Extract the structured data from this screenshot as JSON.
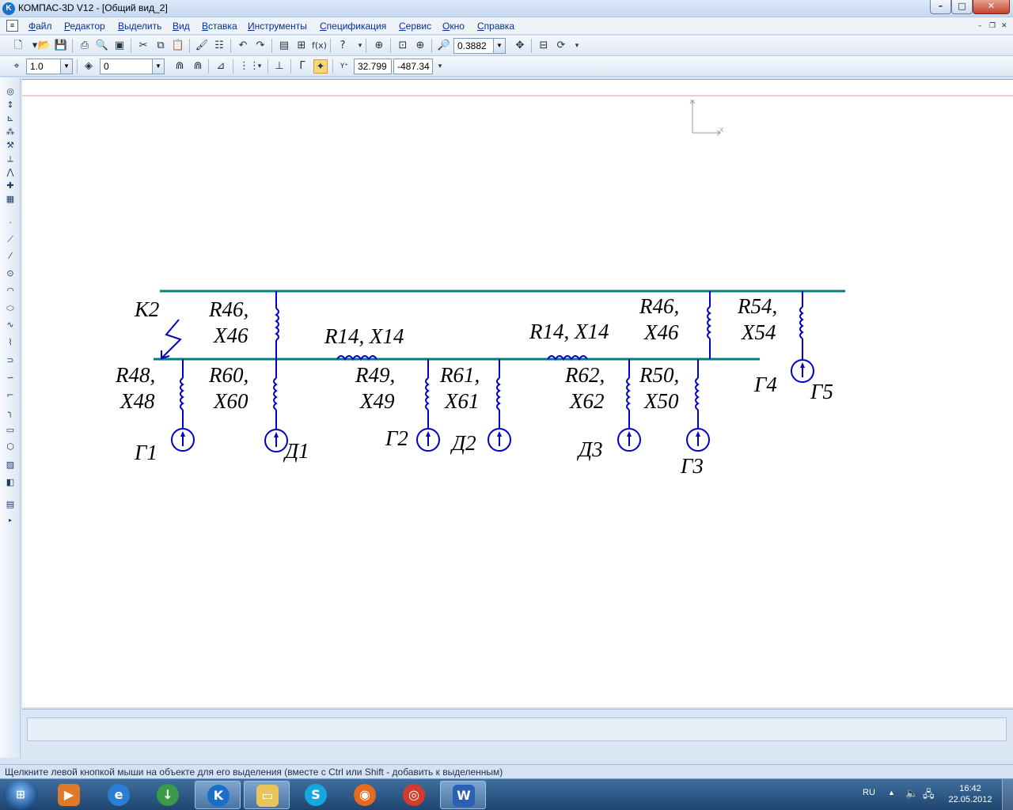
{
  "window": {
    "title": "КОМПАС-3D V12 - [Общий вид_2]",
    "minimize": "–",
    "maximize": "□",
    "close": "✕"
  },
  "menu": {
    "items": [
      "Файл",
      "Редактор",
      "Выделить",
      "Вид",
      "Вставка",
      "Инструменты",
      "Спецификация",
      "Сервис",
      "Окно",
      "Справка"
    ]
  },
  "toolbar1": {
    "zoom_value": "0.3882"
  },
  "toolbar2": {
    "line_step": "1.0",
    "layer": "0",
    "coord_x": "32.799",
    "coord_y": "-487.34"
  },
  "coordinate_axes": {
    "y_label": "Y",
    "x_label": "X"
  },
  "diagram": {
    "labels": {
      "k2": "К2",
      "r46_a_1": "R46,",
      "r46_a_2": "X46",
      "r14_a": "R14, X14",
      "r14_b": "R14, X14",
      "r46_b_1": "R46,",
      "r46_b_2": "X46",
      "r54_1": "R54,",
      "r54_2": "X54",
      "r48_1": "R48,",
      "r48_2": "X48",
      "r60_1": "R60,",
      "r60_2": "X60",
      "r49_1": "R49,",
      "r49_2": "X49",
      "r61_1": "R61,",
      "r61_2": "X61",
      "r62_1": "R62,",
      "r62_2": "X62",
      "r50_1": "R50,",
      "r50_2": "X50",
      "g1": "Г1",
      "d1": "Д1",
      "g2": "Г2",
      "d2": "Д2",
      "d3": "Д3",
      "g3": "Г3",
      "g4": "Г4",
      "g5": "Г5"
    },
    "colors": {
      "bus": "#008080",
      "element": "#0000c8"
    }
  },
  "status": {
    "hint": "Щелкните левой кнопкой мыши на объекте для его выделения (вместе с Ctrl или Shift - добавить к выделенным)"
  },
  "taskbar": {
    "lang": "RU",
    "time": "16:42",
    "date": "22.05.2012"
  }
}
